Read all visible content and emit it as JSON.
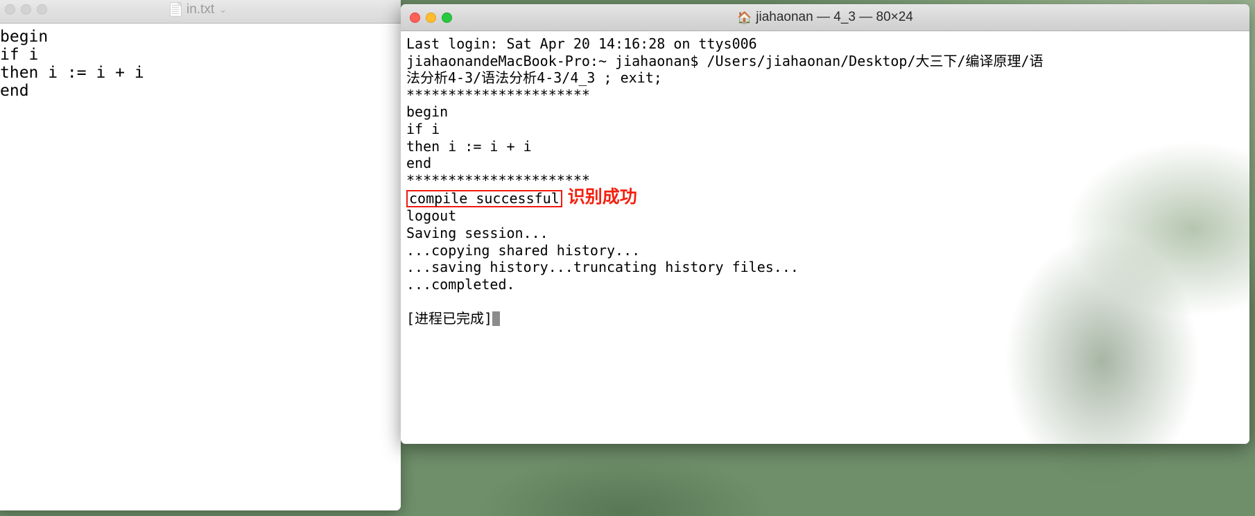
{
  "desktop": {
    "background_color": "#7f9a77"
  },
  "textedit": {
    "window_name": "in.txt",
    "title": "in.txt",
    "chevron": "⌄",
    "traffic_lights": [
      "close",
      "minimize",
      "maximize"
    ],
    "content_lines": [
      "begin",
      "if i",
      "then i := i + i",
      "end"
    ]
  },
  "terminal": {
    "title": "jiahaonan — 4_3 — 80×24",
    "house_icon": "🏠",
    "traffic_lights": [
      "close",
      "minimize",
      "maximize"
    ],
    "lines": [
      "Last login: Sat Apr 20 14:16:28 on ttys006",
      "jiahaonandeMacBook-Pro:~ jiahaonan$ /Users/jiahaonan/Desktop/大三下/编译原理/语",
      "法分析4-3/语法分析4-3/4_3 ; exit;",
      "**********************",
      "begin",
      "if i",
      "then i := i + i",
      "end",
      "**********************"
    ],
    "highlighted_line": "compile successful",
    "annotation": "识别成功",
    "annotation_color": "#f4200f",
    "box_color": "#f01a10",
    "lines_after": [
      "logout",
      "Saving session...",
      "...copying shared history...",
      "...saving history...truncating history files...",
      "...completed."
    ],
    "final_status": "[进程已完成]"
  }
}
